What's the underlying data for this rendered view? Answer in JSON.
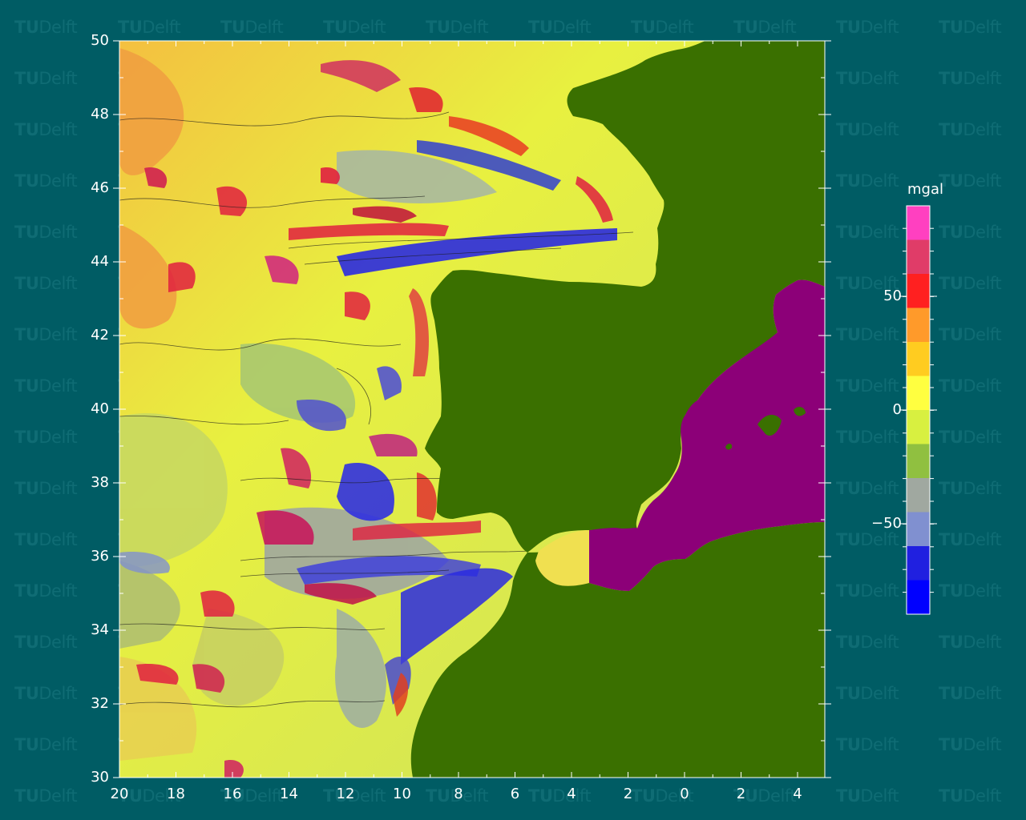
{
  "watermark": {
    "tu": "TU",
    "delft": "Delft"
  },
  "map": {
    "title": "",
    "x_axis": {
      "tick_labels": [
        "20",
        "18",
        "16",
        "14",
        "12",
        "10",
        "8",
        "6",
        "4",
        "2",
        "0",
        "2",
        "4"
      ]
    },
    "y_axis": {
      "tick_labels": [
        "50",
        "48",
        "46",
        "44",
        "42",
        "40",
        "38",
        "36",
        "34",
        "32",
        "30"
      ]
    },
    "colors": {
      "background": "#005c64",
      "land": "#3a7000",
      "mask_region": "#8c0078",
      "axis": "#ffffff"
    }
  },
  "colorbar": {
    "unit_label": "mgal",
    "tick_labels": [
      "50",
      "0",
      "−50"
    ],
    "colors": [
      "#ff40c0",
      "#e03c68",
      "#ff2020",
      "#ff9a2a",
      "#ffcc20",
      "#ffff40",
      "#d8f040",
      "#90c040",
      "#a0a8a0",
      "#8090d0",
      "#2020e0",
      "#0000ff"
    ]
  }
}
